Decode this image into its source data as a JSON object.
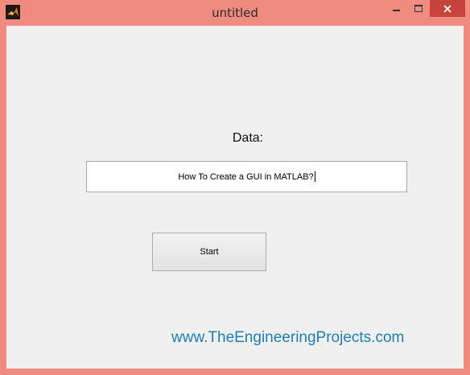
{
  "window": {
    "title": "untitled",
    "title_bar_color": "#f08b7f",
    "close_button_color": "#c7443c"
  },
  "icons": {
    "app": "matlab-logo-icon",
    "minimize": "minimize-icon",
    "maximize": "maximize-icon",
    "close": "close-icon"
  },
  "form": {
    "data_label": "Data:",
    "text_value": "How To Create a GUI in MATLAB?",
    "start_label": "Start"
  },
  "watermark": {
    "text": "www.TheEngineeringProjects.com",
    "color": "#1e7fb6"
  }
}
